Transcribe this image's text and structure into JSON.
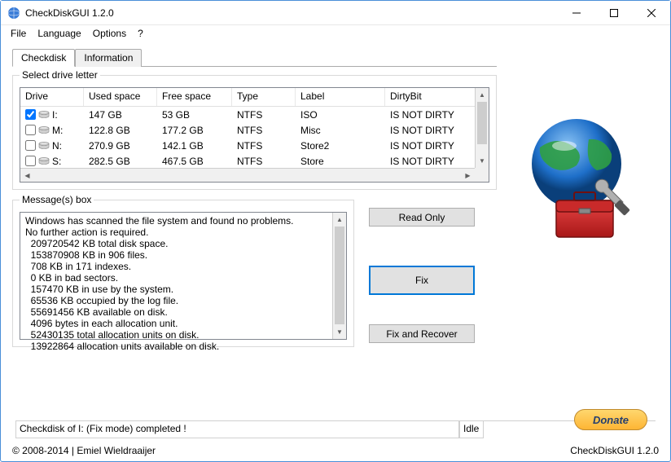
{
  "title": "CheckDiskGUI 1.2.0",
  "menu": {
    "file": "File",
    "language": "Language",
    "options": "Options",
    "help": "?"
  },
  "tabs": {
    "checkdisk": "Checkdisk",
    "information": "Information"
  },
  "drive_group": "Select drive letter",
  "drive_columns": {
    "drive": "Drive",
    "used": "Used space",
    "free": "Free space",
    "type": "Type",
    "label": "Label",
    "dirty": "DirtyBit"
  },
  "drives": [
    {
      "checked": true,
      "letter": "I:",
      "used": "147 GB",
      "free": "53 GB",
      "type": "NTFS",
      "label": "ISO",
      "dirty": "IS NOT DIRTY"
    },
    {
      "checked": false,
      "letter": "M:",
      "used": "122.8 GB",
      "free": "177.2 GB",
      "type": "NTFS",
      "label": "Misc",
      "dirty": "IS NOT DIRTY"
    },
    {
      "checked": false,
      "letter": "N:",
      "used": "270.9 GB",
      "free": "142.1 GB",
      "type": "NTFS",
      "label": "Store2",
      "dirty": "IS NOT DIRTY"
    },
    {
      "checked": false,
      "letter": "S:",
      "used": "282.5 GB",
      "free": "467.5 GB",
      "type": "NTFS",
      "label": "Store",
      "dirty": "IS NOT DIRTY"
    }
  ],
  "msg_group": "Message(s) box",
  "messages": [
    "Windows has scanned the file system and found no problems.",
    "No further action is required.",
    "  209720542 KB total disk space.",
    "  153870908 KB in 906 files.",
    "  708 KB in 171 indexes.",
    "  0 KB in bad sectors.",
    "  157470 KB in use by the system.",
    "  65536 KB occupied by the log file.",
    "  55691456 KB available on disk.",
    "  4096 bytes in each allocation unit.",
    "  52430135 total allocation units on disk.",
    "  13922864 allocation units available on disk."
  ],
  "buttons": {
    "readonly": "Read Only",
    "fix": "Fix",
    "fixrecover": "Fix and Recover"
  },
  "status": {
    "main": "Checkdisk of I: (Fix mode) completed !",
    "state": "Idle"
  },
  "donate": "Donate",
  "footer": {
    "copyright": "© 2008-2014 | Emiel Wieldraaijer",
    "version": "CheckDiskGUI 1.2.0"
  }
}
